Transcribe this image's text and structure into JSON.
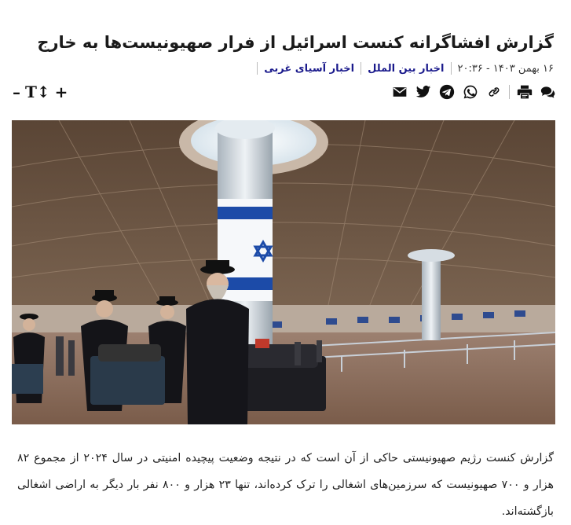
{
  "article": {
    "title": "گزارش افشاگرانه کنست اسرائیل از فرار صهیونیست‌ها به خارج",
    "date": "۱۶ بهمن ۱۴۰۳ - ۲۰:۳۶",
    "categories": [
      "اخبار بین الملل",
      "اخبار آسیای غربی"
    ],
    "lead": "گزارش کنست رژیم صهیونیستی حاکی از آن است که در نتیجه وضعیت پیچیده امنیتی در سال ۲۰۲۴ از مجموع ۸۲ هزار و ۷۰۰ صهیونیست که سرزمین‌های اشغالی را ترک کرده‌اند، تنها ۲۳ هزار و ۸۰۰ نفر بار دیگر به اراضی اشغالی بازگشته‌اند."
  },
  "font_controls": {
    "increase": "+",
    "size": "T↕",
    "decrease": "–"
  },
  "share_icons": [
    "comments-icon",
    "print-icon",
    "copy-link-icon",
    "whatsapp-icon",
    "telegram-icon",
    "twitter-icon",
    "email-icon"
  ],
  "colors": {
    "category_link": "#1a1a8c",
    "text": "#222222"
  }
}
